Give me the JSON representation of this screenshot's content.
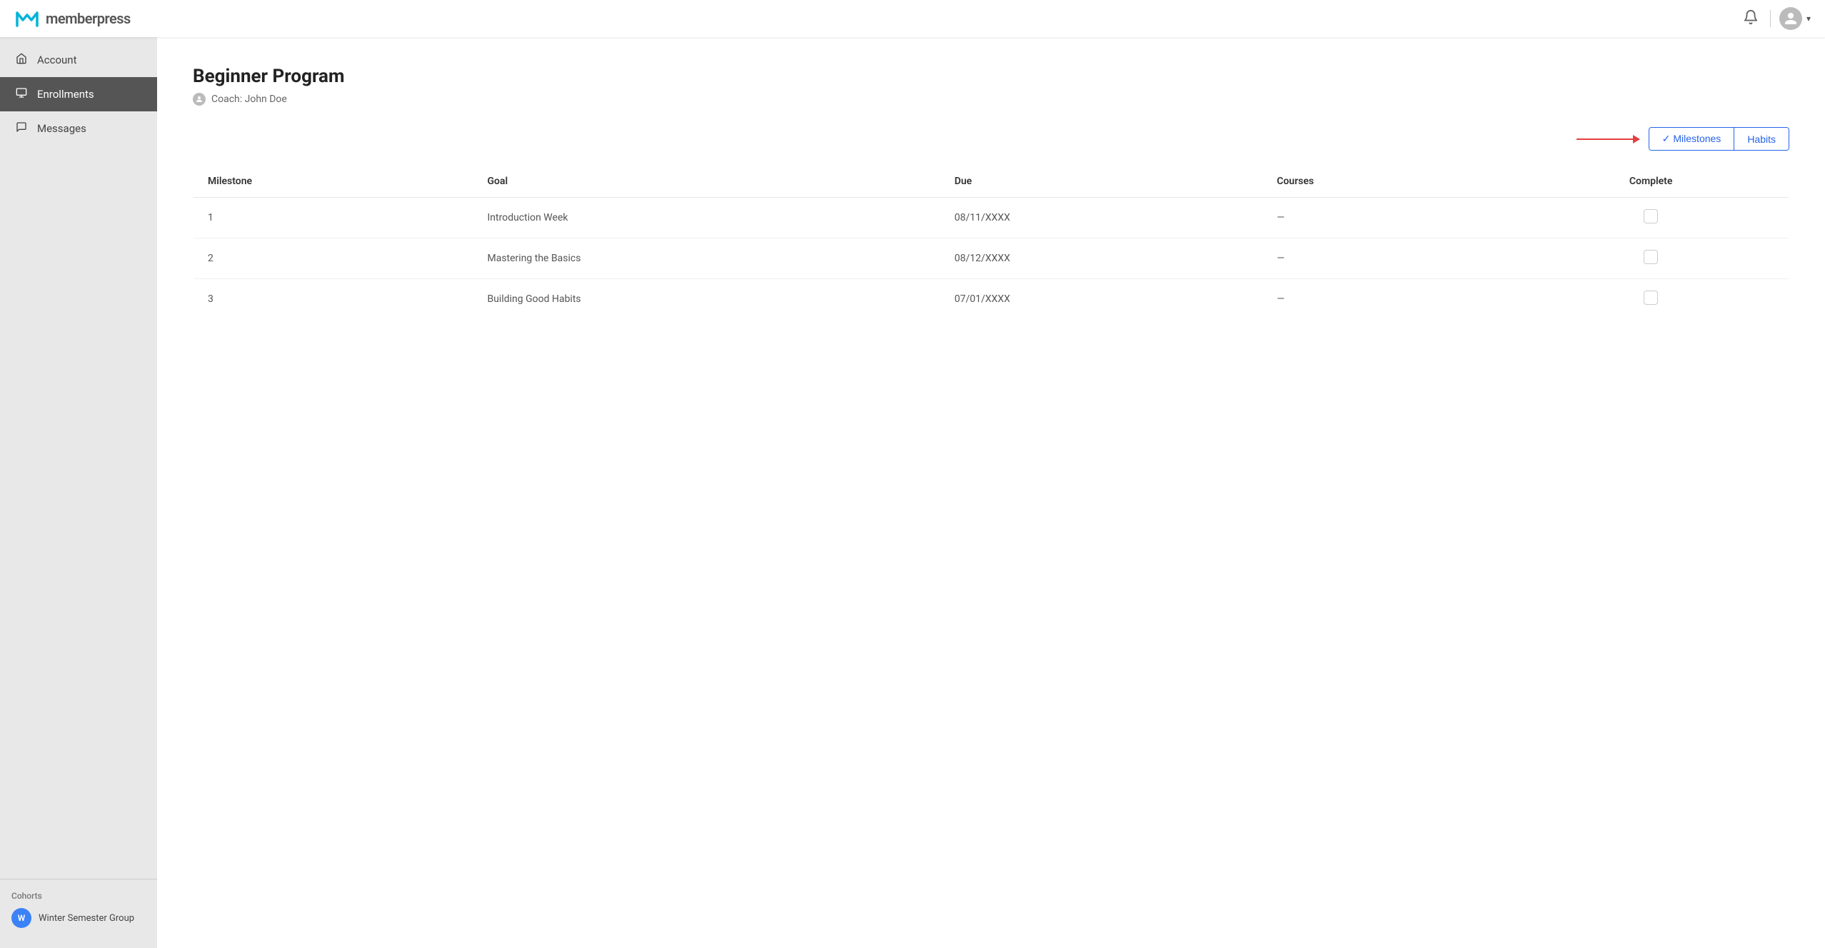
{
  "header": {
    "logo_text": "memberpress",
    "bell_label": "notifications",
    "avatar_label": "user avatar",
    "chevron_label": "expand"
  },
  "sidebar": {
    "items": [
      {
        "id": "account",
        "label": "Account",
        "icon": "🏠",
        "active": false
      },
      {
        "id": "enrollments",
        "label": "Enrollments",
        "icon": "📋",
        "active": true
      },
      {
        "id": "messages",
        "label": "Messages",
        "icon": "💬",
        "active": false
      }
    ],
    "cohorts_label": "Cohorts",
    "cohort": {
      "initial": "W",
      "name": "Winter Semester Group"
    }
  },
  "page": {
    "title": "Beginner Program",
    "coach_label": "Coach: John Doe"
  },
  "tabs": [
    {
      "id": "milestones",
      "label": "Milestones",
      "active": true,
      "check": true
    },
    {
      "id": "habits",
      "label": "Habits",
      "active": false,
      "check": false
    }
  ],
  "table": {
    "columns": [
      "Milestone",
      "Goal",
      "Due",
      "Courses",
      "Complete"
    ],
    "rows": [
      {
        "num": "1",
        "goal": "Introduction Week",
        "due": "08/11/XXXX",
        "courses": "—"
      },
      {
        "num": "2",
        "goal": "Mastering the Basics",
        "due": "08/12/XXXX",
        "courses": "—"
      },
      {
        "num": "3",
        "goal": "Building Good Habits",
        "due": "07/01/XXXX",
        "courses": "—"
      }
    ]
  }
}
